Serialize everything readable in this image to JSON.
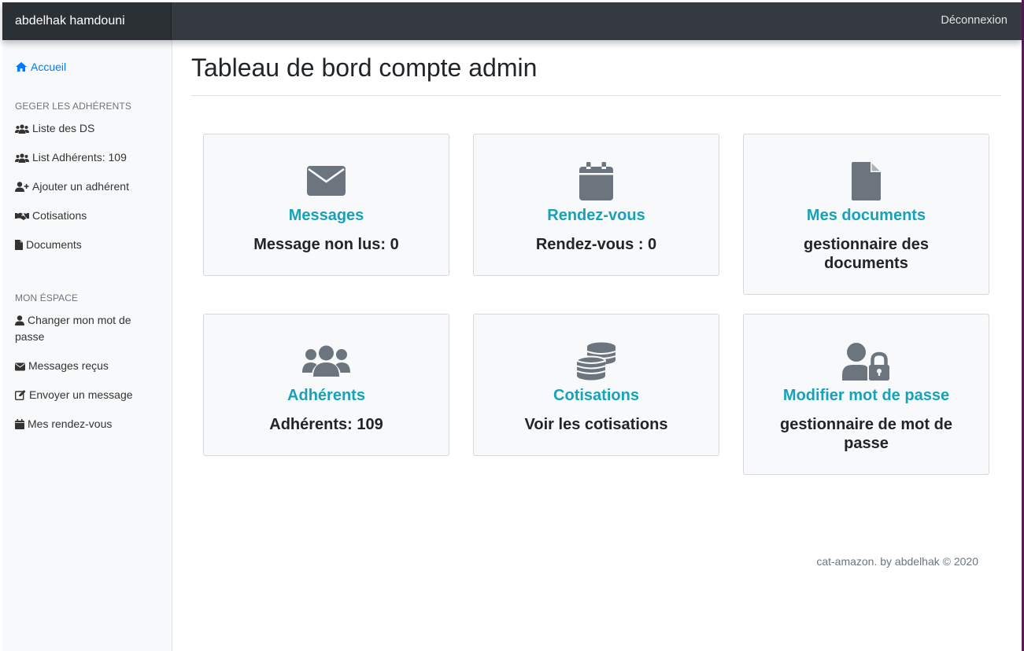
{
  "navbar": {
    "brand": "abdelhak hamdouni",
    "logout_label": "Déconnexion"
  },
  "sidebar": {
    "home_label": "Accueil",
    "section1_heading": "GEGER LES ADHÉRENTS",
    "section1_items": [
      {
        "label": "Liste des DS",
        "icon": "users-icon"
      },
      {
        "label": "List Adhérents: 109",
        "icon": "users-icon"
      },
      {
        "label": "Ajouter un adhérent",
        "icon": "user-plus-icon"
      },
      {
        "label": "Cotisations",
        "icon": "handshake-icon"
      },
      {
        "label": "Documents",
        "icon": "file-icon"
      }
    ],
    "section2_heading": "MON ÉSPACE",
    "section2_items": [
      {
        "label": "Changer mon mot de passe",
        "icon": "user-icon"
      },
      {
        "label": "Messages reçus",
        "icon": "envelope-icon"
      },
      {
        "label": "Envoyer un message",
        "icon": "edit-icon"
      },
      {
        "label": "Mes rendez-vous",
        "icon": "calendar-icon"
      }
    ]
  },
  "main": {
    "title": "Tableau de bord compte admin",
    "cards": [
      {
        "title": "Messages",
        "text": "Message non lus: 0",
        "icon": "envelope-icon"
      },
      {
        "title": "Rendez-vous",
        "text": "Rendez-vous : 0",
        "icon": "calendar-icon"
      },
      {
        "title": "Mes documents",
        "text": "gestionnaire des documents",
        "icon": "file-icon"
      },
      {
        "title": "Adhérents",
        "text": "Adhérents: 109",
        "icon": "users-icon"
      },
      {
        "title": "Cotisations",
        "text": "Voir les cotisations",
        "icon": "coins-icon"
      },
      {
        "title": "Modifier mot de passe",
        "text": "gestionnaire de mot de passe",
        "icon": "user-lock-icon"
      }
    ]
  },
  "footer": {
    "text": "cat-amazon. by abdelhak © 2020"
  },
  "colors": {
    "navbar_bg": "#343a40",
    "card_title": "#17a2b8",
    "icon_gray": "#6c757d",
    "link_active": "#007bff"
  }
}
